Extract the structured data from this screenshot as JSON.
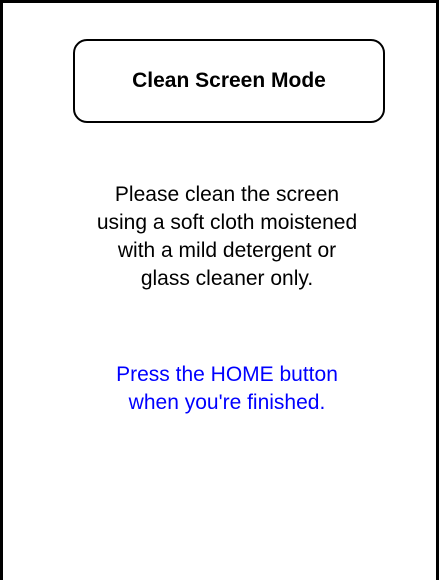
{
  "title_box": {
    "label": "Clean Screen Mode"
  },
  "instructions": {
    "lines": [
      "Please clean the screen",
      "using a soft cloth moistened",
      "with a mild detergent or",
      "glass cleaner only."
    ]
  },
  "finish_note": {
    "lines": [
      "Press the HOME button",
      "when you're finished."
    ]
  },
  "colors": {
    "text": "#000000",
    "note": "#0000ff",
    "background": "#ffffff",
    "border": "#000000"
  }
}
